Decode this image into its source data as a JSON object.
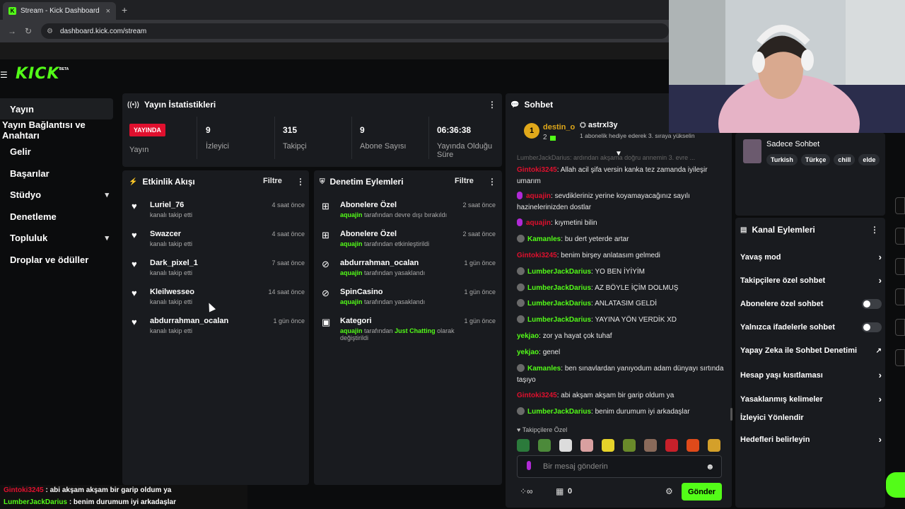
{
  "browser": {
    "tab_title": "Stream - Kick Dashboard",
    "tab_favicon": "K",
    "url": "dashboard.kick.com/stream",
    "new_tab": "+",
    "close": "×"
  },
  "brand": {
    "logo": "KICK",
    "beta": "BETA",
    "accent": "#53fc18"
  },
  "sidebar": {
    "items": [
      {
        "label": "Yayın",
        "active": true
      },
      {
        "label": "Yayın Bağlantısı ve Anahtarı"
      },
      {
        "label": "Gelir"
      },
      {
        "label": "Başarılar"
      },
      {
        "label": "Stüdyo",
        "chevron": true
      },
      {
        "label": "Denetleme"
      },
      {
        "label": "Topluluk",
        "chevron": true
      },
      {
        "label": "Droplar ve ödüller"
      }
    ]
  },
  "stats": {
    "title": "Yayın İstatistikleri",
    "live_badge": "YAYINDA",
    "live_label": "Yayın",
    "items": [
      {
        "value": "9",
        "label": "İzleyici"
      },
      {
        "value": "315",
        "label": "Takipçi"
      },
      {
        "value": "9",
        "label": "Abone Sayısı"
      },
      {
        "value": "06:36:38",
        "label": "Yayında Olduğu Süre"
      }
    ]
  },
  "activity": {
    "title": "Etkinlik Akışı",
    "filter": "Filtre",
    "items": [
      {
        "name": "Luriel_76",
        "sub": "kanalı takip etti",
        "time": "4 saat önce"
      },
      {
        "name": "Swazcer",
        "sub": "kanalı takip etti",
        "time": "4 saat önce"
      },
      {
        "name": "Dark_pixel_1",
        "sub": "kanalı takip etti",
        "time": "7 saat önce"
      },
      {
        "name": "Kleilwesseo",
        "sub": "kanalı takip etti",
        "time": "14 saat önce"
      },
      {
        "name": "abdurrahman_ocalan",
        "sub": "kanalı takip etti",
        "time": "1 gün önce"
      }
    ]
  },
  "moderation": {
    "title": "Denetim Eylemleri",
    "filter": "Filtre",
    "items": [
      {
        "name": "Abonelere Özel",
        "actor": "aquajin",
        "sub": "tarafından devre dışı bırakıldı",
        "time": "2 saat önce"
      },
      {
        "name": "Abonelere Özel",
        "actor": "aquajin",
        "sub": "tarafından etkinleştirildi",
        "time": "2 saat önce"
      },
      {
        "name": "abdurrahman_ocalan",
        "actor": "aquajin",
        "sub": "tarafından yasaklandı",
        "time": "1 gün önce"
      },
      {
        "name": "SpinCasino",
        "actor": "aquajin",
        "sub": "tarafından yasaklandı",
        "time": "1 gün önce"
      },
      {
        "name": "Kategori",
        "actor": "aquajin",
        "sub": "tarafından",
        "highlight": "Just Chatting",
        "sub2": "olarak",
        "sub3": "değiştirildi",
        "time": "1 gün önce"
      }
    ]
  },
  "chat": {
    "title": "Sohbet",
    "pinned": {
      "rank": "1",
      "user1": "destin_o",
      "count": "2",
      "user2": "astrxl3y",
      "gift_text": "1 abonelik hediye ederek 3. sıraya yükselin"
    },
    "faded_line": "LumberJackDarius: ardından akşama doğru annemin 3. evre ...",
    "messages": [
      {
        "user": "Gintoki3245",
        "color": "#e0102e",
        "text": "Allah acil şifa versin kanka tez zamanda iyileşir umarım"
      },
      {
        "user": "aquajin",
        "color": "#e0102e",
        "badge": "mic",
        "text": "sevdikleriniz yerine koyamayacağınız sayılı hazinelerinizden dostlar"
      },
      {
        "user": "aquajin",
        "color": "#e0102e",
        "badge": "mic",
        "text": "kıymetini bilin"
      },
      {
        "user": "Kamanles",
        "color": "#53fc18",
        "badge": "av",
        "text": "bu dert yeterde artar"
      },
      {
        "user": "Gintoki3245",
        "color": "#e0102e",
        "text": "benim birşey anlatasım gelmedi"
      },
      {
        "user": "LumberJackDarius",
        "color": "#53fc18",
        "badge": "av",
        "text": "YO BEN İYİYİM"
      },
      {
        "user": "LumberJackDarius",
        "color": "#53fc18",
        "badge": "av",
        "text": "AZ BÖYLE İÇİM DOLMUŞ"
      },
      {
        "user": "LumberJackDarius",
        "color": "#53fc18",
        "badge": "av",
        "text": "ANLATASIM GELDİ"
      },
      {
        "user": "LumberJackDarius",
        "color": "#53fc18",
        "badge": "av",
        "text": "YAYINA YÖN VERDİK XD"
      },
      {
        "user": "yekjao",
        "color": "#53fc18",
        "text": "zor ya hayat çok tuhaf"
      },
      {
        "user": "yekjao",
        "color": "#53fc18",
        "text": "genel"
      },
      {
        "user": "Kamanles",
        "color": "#53fc18",
        "badge": "av",
        "text": "ben sınavlardan yanıyodum adam dünyayı sırtında taşıyo"
      },
      {
        "user": "Gintoki3245",
        "color": "#e0102e",
        "text": "abi akşam akşam bir garip oldum ya"
      },
      {
        "user": "LumberJackDarius",
        "color": "#53fc18",
        "badge": "av",
        "text": "benim durumum iyi arkadaşlar"
      }
    ],
    "followers_only": "Takipçilere Özel",
    "input_placeholder": "Bir mesaj gönderin",
    "count": "0",
    "send": "Gönder"
  },
  "chat_mode": {
    "label": "Sadece Sohbet",
    "tags": [
      "Turkish",
      "Türkçe",
      "chill",
      "elde"
    ]
  },
  "channel_actions": {
    "title": "Kanal Eylemleri",
    "items": [
      {
        "label": "Yavaş mod",
        "ctrl": "chev"
      },
      {
        "label": "Takipçilere özel sohbet",
        "ctrl": "chev"
      },
      {
        "label": "Abonelere özel sohbet",
        "ctrl": "toggle",
        "on": false
      },
      {
        "label": "Yalnızca ifadelerle sohbet",
        "ctrl": "toggle",
        "on": false
      },
      {
        "label": "Yapay Zeka ile Sohbet Denetimi",
        "ctrl": "ext"
      },
      {
        "label": "Hesap yaşı kısıtlaması",
        "ctrl": "chev"
      },
      {
        "label": "Yasaklanmış kelimeler",
        "ctrl": "chev"
      },
      {
        "label": "İzleyici Yönlendir",
        "ctrl": ""
      },
      {
        "label": "Hedefleri belirleyin",
        "ctrl": "chev"
      }
    ]
  },
  "overlay": [
    {
      "user": "Gintoki3245",
      "text": " : abi akşam akşam bir garip oldum ya"
    },
    {
      "user": "LumberJackDarius",
      "text": " : benim durumum iyi arkadaşlar"
    }
  ]
}
